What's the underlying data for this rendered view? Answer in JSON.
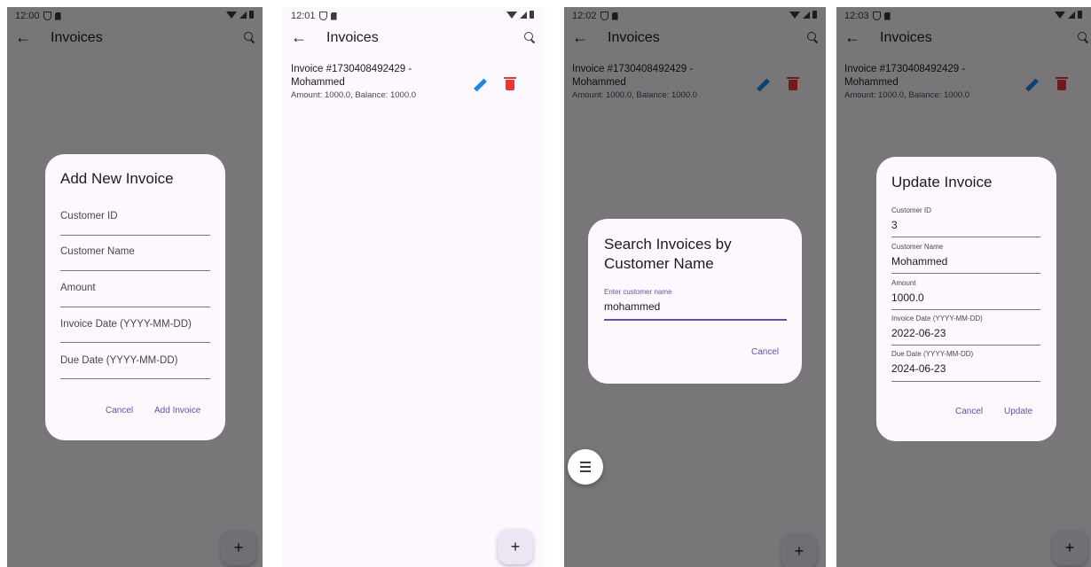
{
  "screens": [
    {
      "time": "12:00",
      "app_title": "Invoices",
      "dialog": {
        "title": "Add New Invoice",
        "fields": [
          "Customer ID",
          "Customer Name",
          "Amount",
          "Invoice Date (YYYY-MM-DD)",
          "Due Date (YYYY-MM-DD)"
        ],
        "cancel_label": "Cancel",
        "confirm_label": "Add Invoice"
      },
      "fab_icon": "+"
    },
    {
      "time": "12:01",
      "app_title": "Invoices",
      "invoice": {
        "title": "Invoice #1730408492429 - Mohammed",
        "subtitle": "Amount: 1000.0, Balance: 1000.0"
      },
      "fab_icon": "+"
    },
    {
      "time": "12:02",
      "app_title": "Invoices",
      "invoice": {
        "title": "Invoice #1730408492429 - Mohammed",
        "subtitle": "Amount: 1000.0, Balance: 1000.0"
      },
      "dialog": {
        "title": "Search Invoices by Customer Name",
        "field_label": "Enter customer name",
        "field_value": "mohammed",
        "cancel_label": "Cancel"
      },
      "fab_icon": "+"
    },
    {
      "time": "12:03",
      "app_title": "Invoices",
      "invoice": {
        "title": "Invoice #1730408492429 - Mohammed",
        "subtitle": "Amount: 1000.0, Balance: 1000.0"
      },
      "dialog": {
        "title": "Update Invoice",
        "fields": [
          {
            "label": "Customer ID",
            "value": "3"
          },
          {
            "label": "Customer Name",
            "value": "Mohammed"
          },
          {
            "label": "Amount",
            "value": "1000.0"
          },
          {
            "label": "Invoice Date (YYYY-MM-DD)",
            "value": "2022-06-23"
          },
          {
            "label": "Due Date (YYYY-MM-DD)",
            "value": "2024-06-23"
          }
        ],
        "cancel_label": "Cancel",
        "confirm_label": "Update"
      },
      "fab_icon": "+"
    }
  ],
  "colors": {
    "accent": "#6750a4",
    "edit": "#1e88e5",
    "delete": "#e53935",
    "background": "#fdf7fe"
  }
}
